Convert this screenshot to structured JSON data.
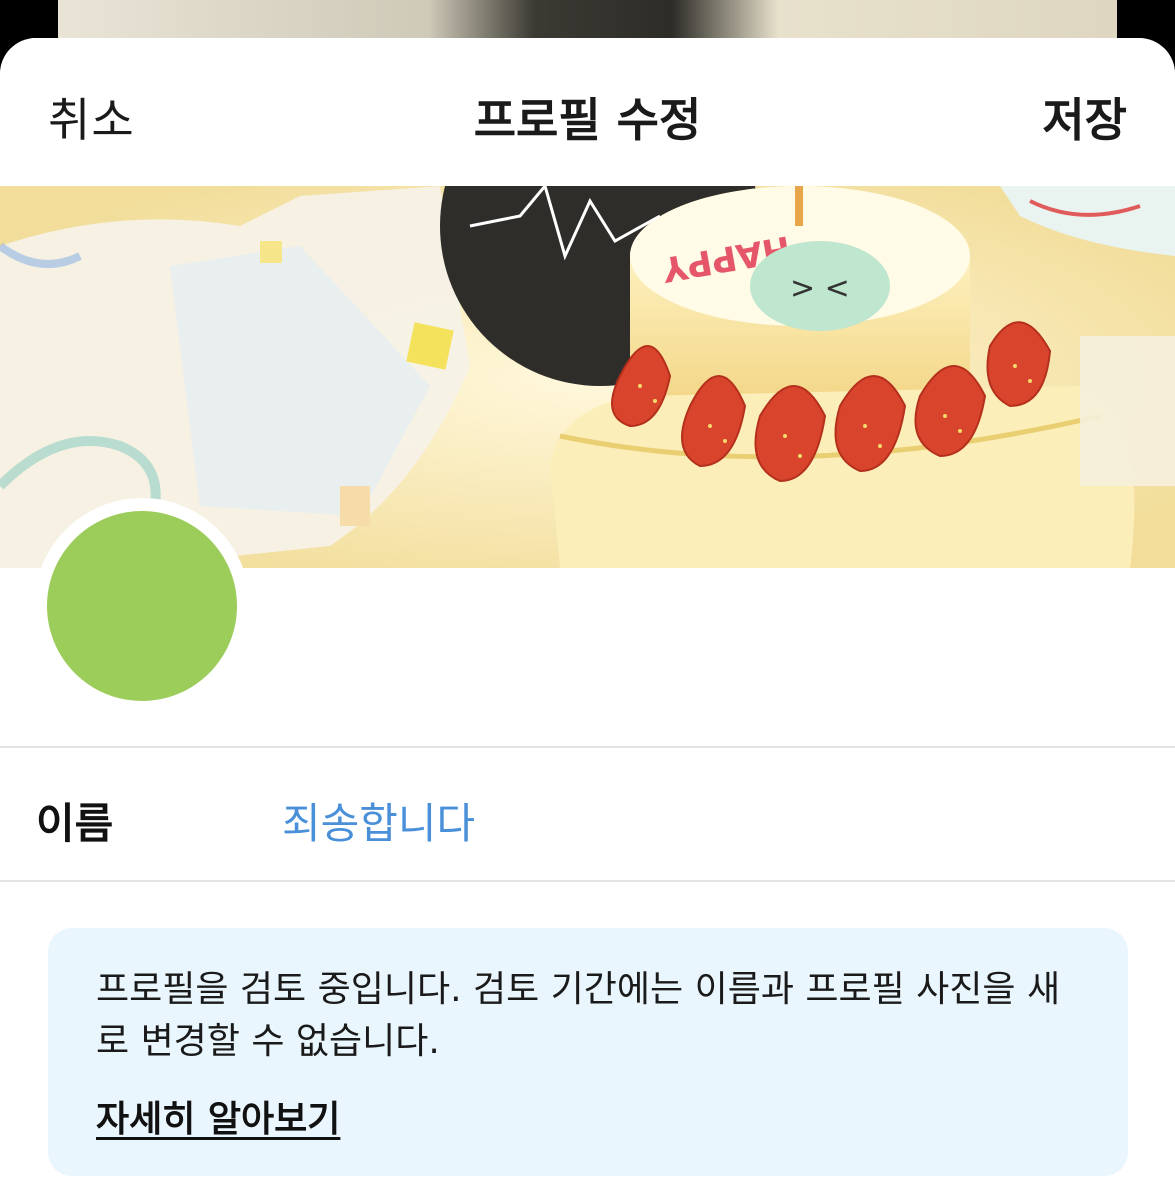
{
  "nav": {
    "cancel_label": "취소",
    "title": "프로필 수정",
    "save_label": "저장"
  },
  "banner": {
    "image_text": "HAPPY"
  },
  "avatar": {
    "color": "#9ccc5a"
  },
  "profile": {
    "name_label": "이름",
    "name_value": "죄송합니다"
  },
  "notice": {
    "message": "프로필을 검토 중입니다. 검토 기간에는 이름과 프로필 사진을 새로 변경할 수 없습니다.",
    "link_label": "자세히 알아보기"
  },
  "colors": {
    "accent": "#4a90d9",
    "notice_bg": "#eaf6fd",
    "divider": "#e3e3e3"
  }
}
